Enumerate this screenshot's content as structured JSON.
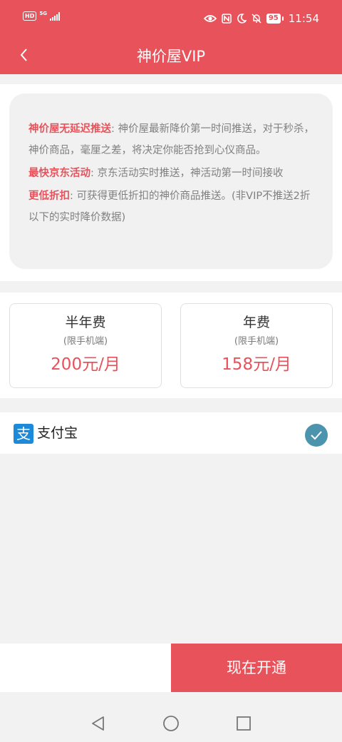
{
  "status_bar": {
    "hd": "HD",
    "network": "5G",
    "battery": "95",
    "time": "11:54"
  },
  "nav": {
    "title": "神价屋VIP"
  },
  "info": {
    "items": [
      {
        "title": "神价屋无延迟推送",
        "text": ": 神价屋最新降价第一时间推送，对于秒杀，神价商品，毫厘之差，将决定你能否抢到心仪商品。"
      },
      {
        "title": "最快京东活动",
        "text": ": 京东活动实时推送，神活动第一时间接收"
      },
      {
        "title": "更低折扣",
        "text": ": 可获得更低折扣的神价商品推送。(非VIP不推送2折以下的实时降价数据)"
      }
    ]
  },
  "plans": [
    {
      "name": "半年费",
      "note": "(限手机端)",
      "price": "200元/月"
    },
    {
      "name": "年费",
      "note": "(限手机端)",
      "price": "158元/月"
    }
  ],
  "payment": {
    "icon_char": "支",
    "label": "支付宝",
    "selected": true
  },
  "actions": {
    "open_label": "现在开通"
  },
  "colors": {
    "primary": "#e8525a",
    "check": "#4c94ad",
    "alipay": "#1c8ad8"
  }
}
